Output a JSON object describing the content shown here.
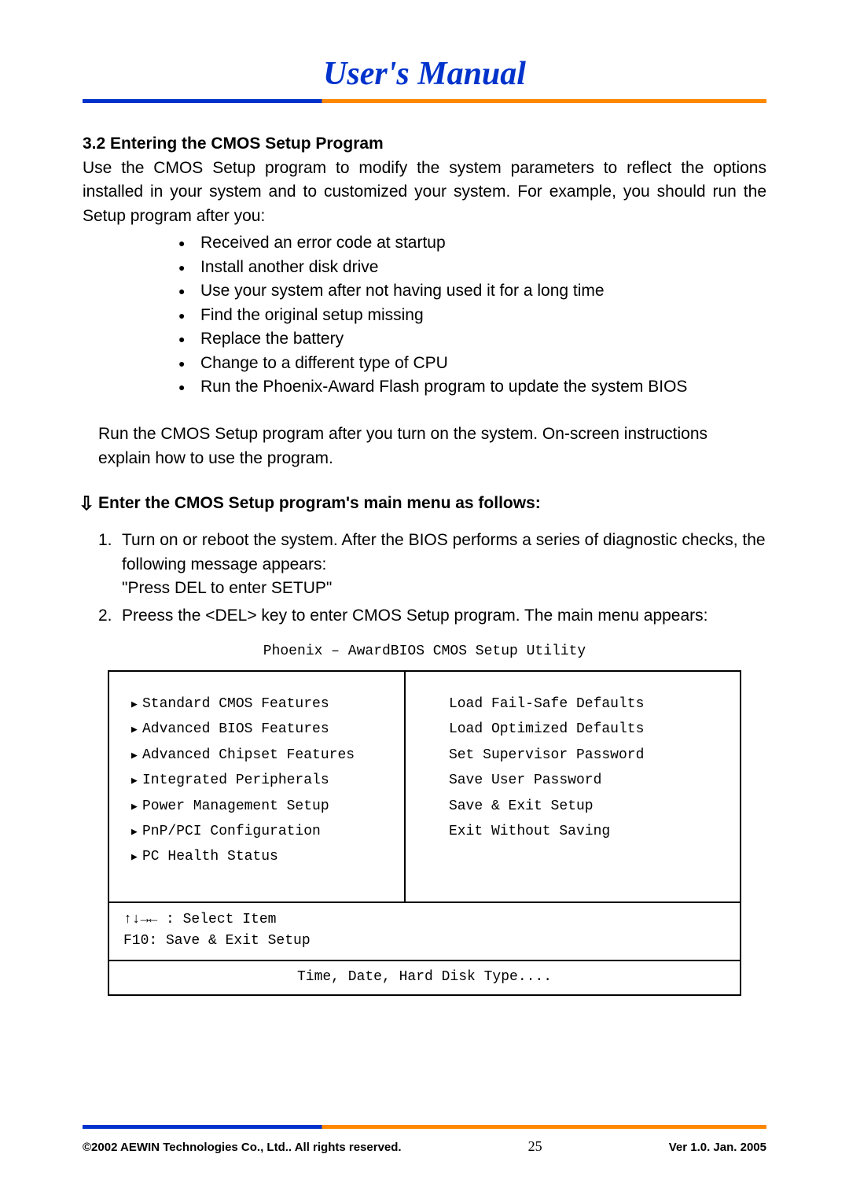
{
  "header": {
    "title": "User's Manual"
  },
  "section": {
    "number_title": "3.2 Entering the CMOS Setup Program",
    "intro": "Use the CMOS Setup program to modify the system parameters to reflect the options installed in your system and to customized your system.    For example, you should run the Setup program after you:",
    "bullets": [
      "Received an error code at startup",
      "Install another disk drive",
      "Use your system after not having used it for a long time",
      "Find the original setup missing",
      "Replace the battery",
      "Change to a different type of CPU",
      "Run the Phoenix-Award Flash program to update the system BIOS"
    ],
    "para2a": "Run the CMOS Setup program after you turn on the system.    On-screen instructions",
    "para2b": "explain how to use the program.",
    "sub_heading": "Enter the CMOS Setup program's main menu as follows:",
    "steps": [
      {
        "num": "1.",
        "text": "Turn on or reboot the system.    After the BIOS performs a series of diagnostic checks, the following message appears:",
        "quote": "\"Press DEL to enter SETUP\""
      },
      {
        "num": "2.",
        "text": "Preess the <DEL> key to enter CMOS Setup program.    The main menu appears:"
      }
    ]
  },
  "bios": {
    "title": "Phoenix – AwardBIOS CMOS Setup Utility",
    "left_items": [
      "Standard CMOS Features",
      "Advanced BIOS Features",
      "Advanced Chipset Features",
      "Integrated Peripherals",
      "Power Management Setup",
      "PnP/PCI Configuration",
      "PC Health Status"
    ],
    "right_items": [
      "Load Fail-Safe Defaults",
      "Load Optimized Defaults",
      "Set Supervisor Password",
      "Save User Password",
      "Save & Exit Setup",
      "Exit Without Saving"
    ],
    "mid1": "↑↓→← : Select Item",
    "mid2": "F10: Save & Exit Setup",
    "bottom": "Time, Date, Hard Disk Type...."
  },
  "footer": {
    "left": "©2002 AEWIN Technologies Co., Ltd.. All rights reserved.",
    "center": "25",
    "right": "Ver 1.0. Jan. 2005"
  }
}
